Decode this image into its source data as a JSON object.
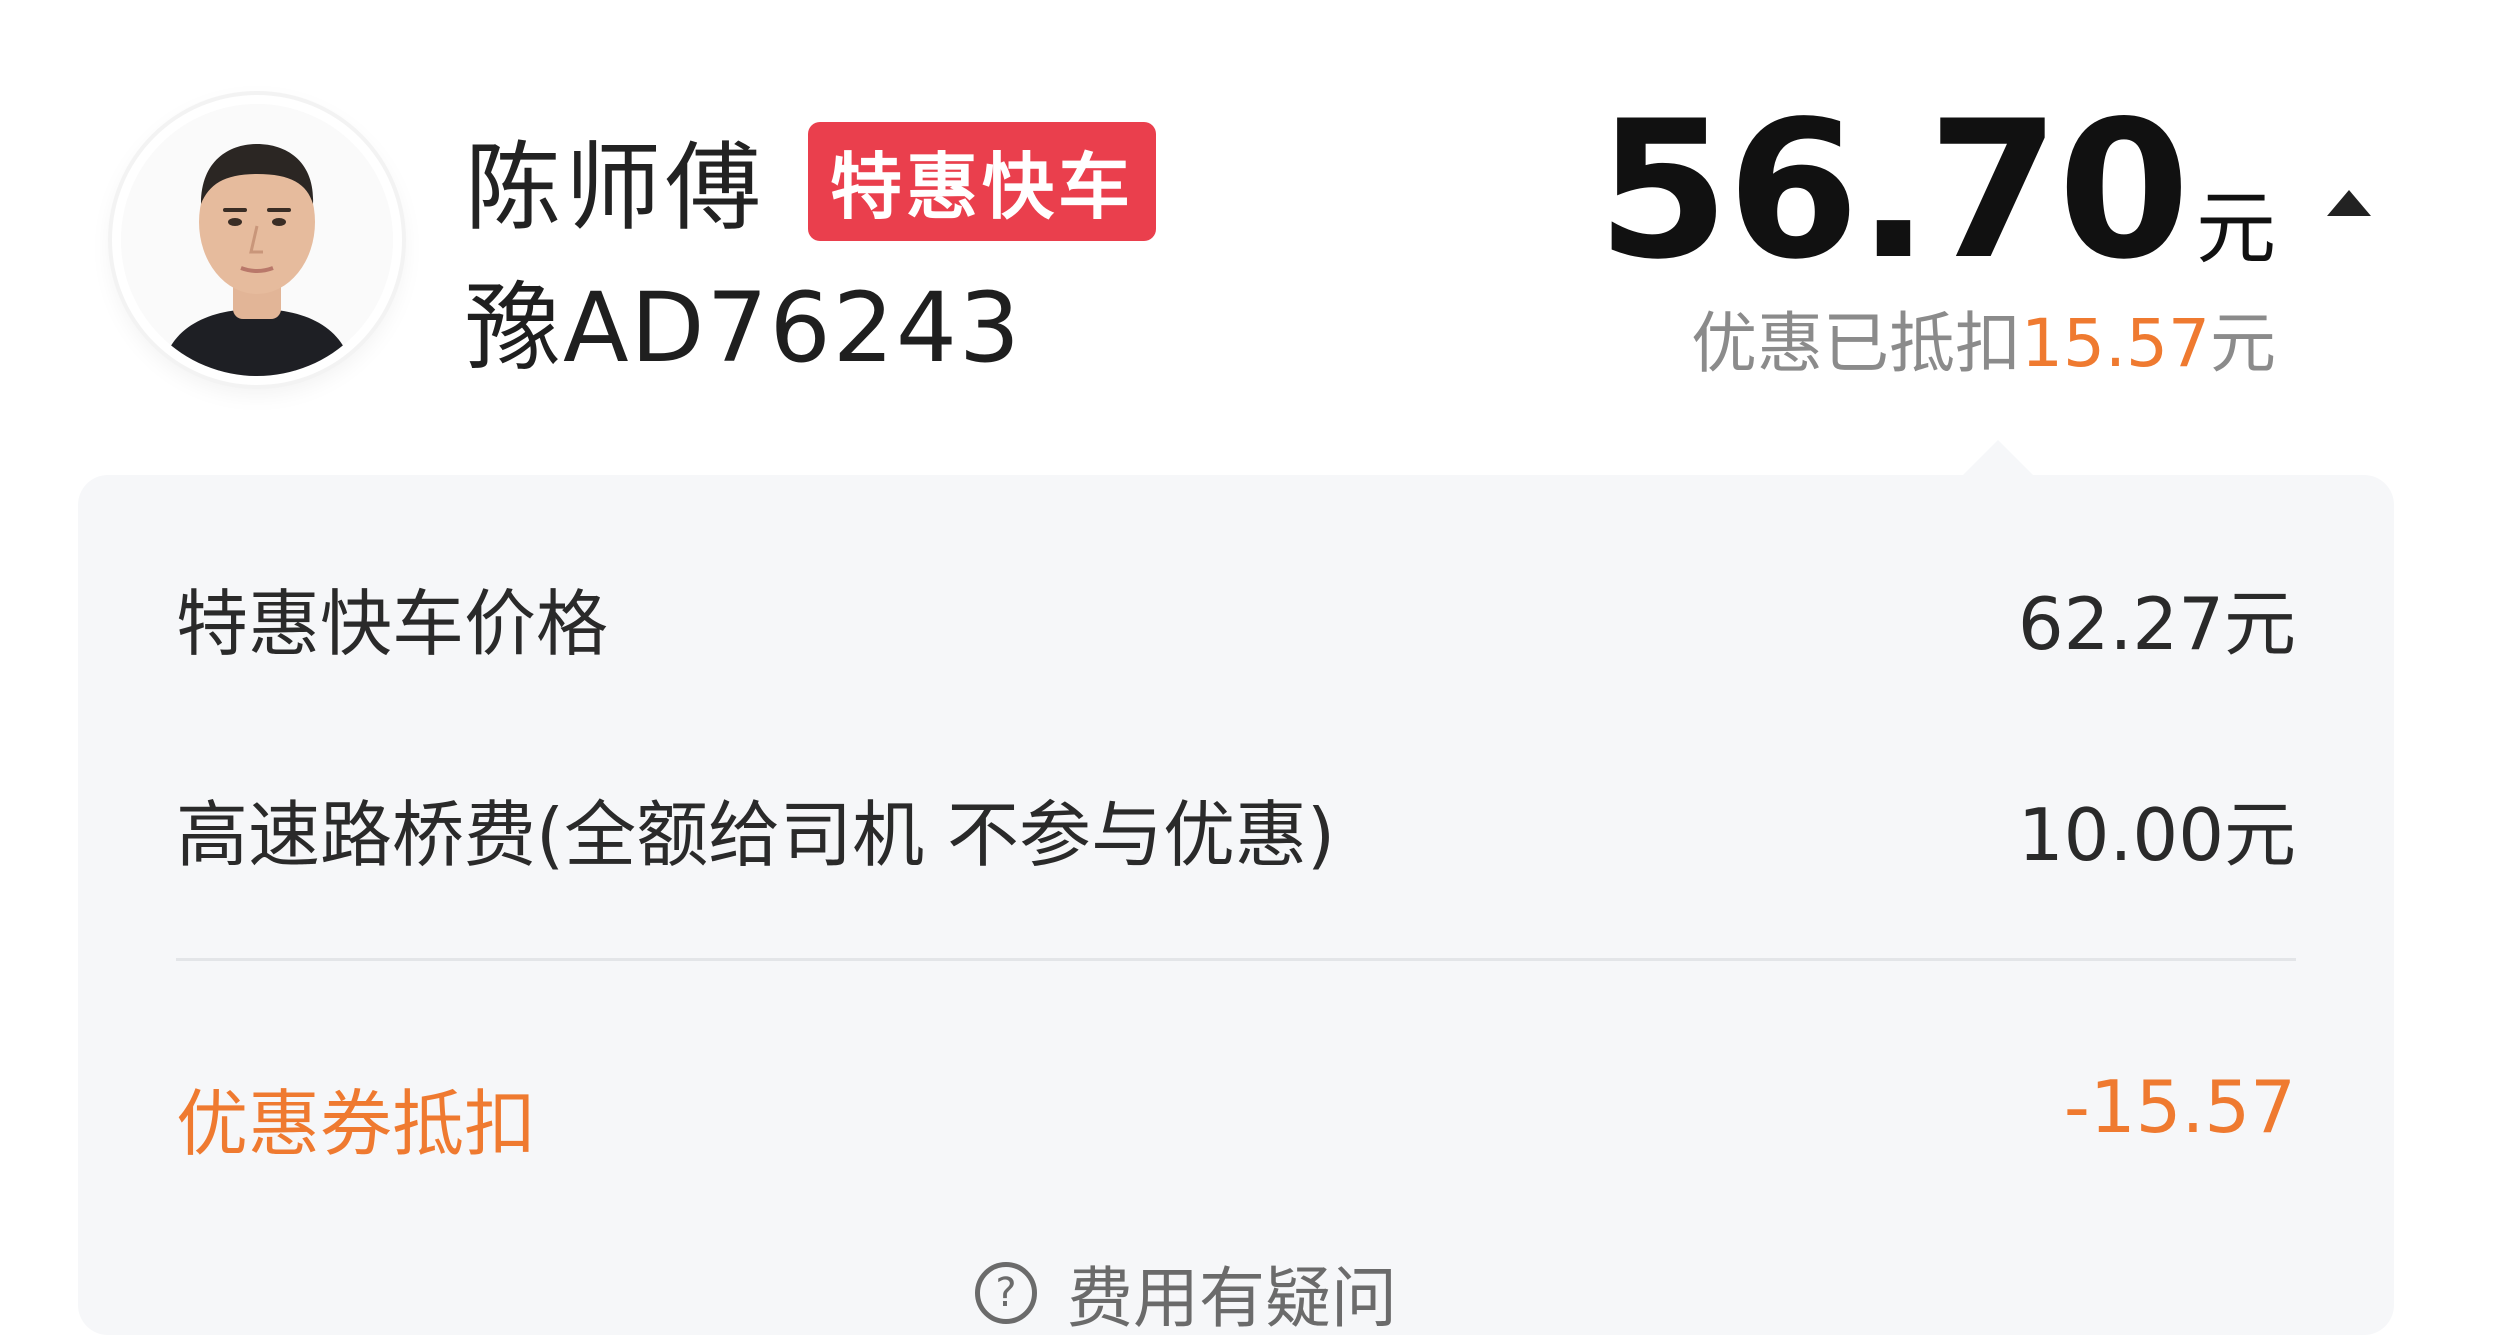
{
  "driver": {
    "name": "陈师傅",
    "plate": "豫AD76243",
    "service_type": "特惠快车"
  },
  "fare": {
    "amount": "56.70",
    "unit": "元",
    "discount_prefix": "优惠已抵扣",
    "discount_amount": "15.57",
    "discount_unit": "元"
  },
  "breakdown": {
    "items": [
      {
        "label": "特惠快车价格",
        "value": "62.27元"
      },
      {
        "label": "高速路桥费(全额给司机 不参与优惠)",
        "value": "10.00元"
      }
    ],
    "coupon": {
      "label": "优惠券抵扣",
      "value": "-15.57"
    }
  },
  "help": {
    "label": "费用有疑问",
    "icon": "question-circle-icon"
  },
  "colors": {
    "badge_bg": "#ea3f4d",
    "discount_orange": "#ef7a30",
    "card_bg": "#f6f7f9"
  }
}
